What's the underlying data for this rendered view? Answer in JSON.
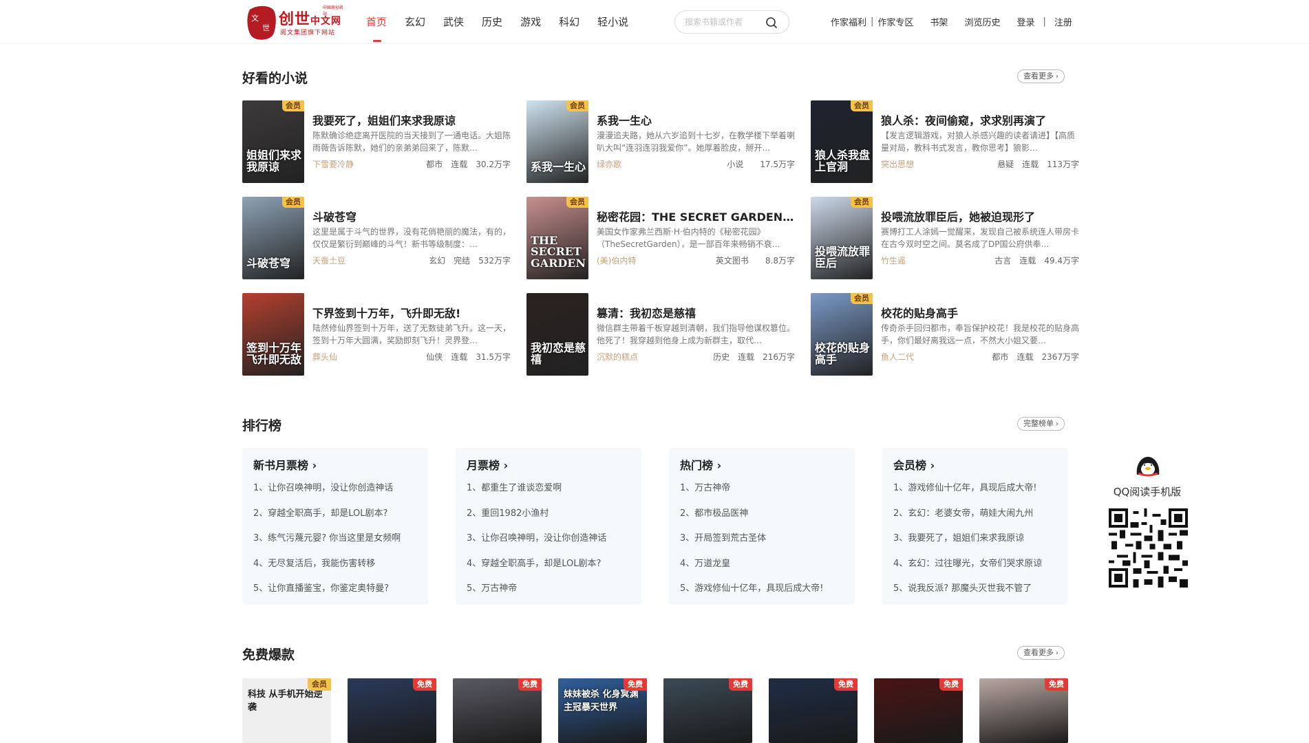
{
  "header": {
    "logo": {
      "seal_text": "文世",
      "brand_main": "创世",
      "brand_sub": "中文网",
      "tagline": "阅文集团旗下网站",
      "tiny": "中国原创名站"
    },
    "nav": [
      "首页",
      "玄幻",
      "武侠",
      "历史",
      "游戏",
      "科幻",
      "轻小说"
    ],
    "search_placeholder": "搜索书籍或作者",
    "links": {
      "author_welfare": "作家福利",
      "author_zone": "作家专区",
      "bookshelf": "书架",
      "history": "浏览历史",
      "login": "登录",
      "register": "注册"
    }
  },
  "section_good": {
    "title": "好看的小说",
    "more": "查看更多",
    "books": [
      {
        "title": "我要死了，姐姐们来求我原谅",
        "desc": "陈默确诊绝症离开医院的当天接到了一通电话。大姐陈雨薇告诉陈默，她们的亲弟弟回来了，陈默…",
        "author": "下雪要冷静",
        "genre": "都市",
        "status": "连载",
        "words": "30.2万字",
        "badge": "会员",
        "cover_text": "姐姐们来求我原谅",
        "cover_color": "#3d3a3b"
      },
      {
        "title": "系我一生心",
        "desc": "漫漫追夫路，她从六岁追到十七岁，在教学楼下举着喇叭大叫“连羽连羽我爱你”。她厚着脸皮，掰开…",
        "author": "绿亦歌",
        "genre": "小说",
        "status": "",
        "words": "17.5万字",
        "badge": "会员",
        "cover_text": "系我一生心",
        "cover_color": "#cfe3ef"
      },
      {
        "title": "狼人杀：夜间偷窥，求求别再演了",
        "desc": "【发言逻辑游戏，对狼人杀感兴趣的读者请进】【高质量对局，教科书式发言，教你思考】狼影…",
        "author": "突出思想",
        "genre": "悬疑",
        "status": "连载",
        "words": "113万字",
        "badge": "会员",
        "cover_text": "狼人杀我盘上官洞",
        "cover_color": "#1e2330"
      },
      {
        "title": "斗破苍穹",
        "desc": "这里是属于斗气的世界，没有花俏艳丽的魔法，有的，仅仅是繁衍到巅峰的斗气！新书等级制度：…",
        "author": "天蚕土豆",
        "genre": "玄幻",
        "status": "完结",
        "words": "532万字",
        "badge": "会员",
        "cover_text": "斗破苍穹",
        "cover_color": "#8ea3b5"
      },
      {
        "title": "秘密花园：THE SECRET GARDEN（英文原版）",
        "desc": "美国女作家弗兰西斯·H·伯内特的《秘密花园》（TheSecretGarden），是一部百年来畅销不衰…",
        "author": "(美)伯内特",
        "genre": "英文图书",
        "status": "",
        "words": "8.8万字",
        "badge": "会员",
        "cover_text": "THE SECRET GARDEN",
        "cover_color": "#c98f8f"
      },
      {
        "title": "投喂流放罪臣后，她被迫现形了",
        "desc": "赛博打工人涂嫣一觉醒来，发现自己被系统连人带房卡在古今双时空之间。莫名成了DP国公府供奉…",
        "author": "竹生遥",
        "genre": "古言",
        "status": "连载",
        "words": "49.4万字",
        "badge": "会员",
        "cover_text": "投喂流放罪臣后",
        "cover_color": "#cdd9e9"
      },
      {
        "title": "下界签到十万年，飞升即无敌!",
        "desc": "陆然修仙界签到十万年，送了无数徒弟飞升。这一天，签到十万年大圆满，奖励即刻飞升！灵界登…",
        "author": "葬头仙",
        "genre": "仙侠",
        "status": "连载",
        "words": "31.5万字",
        "badge": "",
        "cover_text": "签到十万年飞升即无敌",
        "cover_color": "#b4402e"
      },
      {
        "title": "篡清：我初恋是慈禧",
        "desc": "微信群主带着千板穿越到清朝，我们指导他谋权篡位。他死了！我穿越到他身上成为新群主，取代…",
        "author": "沉默的糕点",
        "genre": "历史",
        "status": "连载",
        "words": "216万字",
        "badge": "",
        "cover_text": "我初恋是慈禧",
        "cover_color": "#2a2220"
      },
      {
        "title": "校花的贴身高手",
        "desc": "传奇杀手回归都市，奉旨保护校花！我是校花的贴身高手，你们最好离我远一点，不然大小姐又要…",
        "author": "鱼人二代",
        "genre": "都市",
        "status": "连载",
        "words": "2367万字",
        "badge": "会员",
        "cover_text": "校花的贴身高手",
        "cover_color": "#7b9ac7"
      }
    ]
  },
  "section_rank": {
    "title": "排行榜",
    "more": "完整榜单",
    "panels": [
      {
        "title": "新书月票榜",
        "items": [
          "1、让你召唤神明，没让你创造神话",
          "2、穿越全职高手，却是LOL剧本?",
          "3、练气污蔑元婴? 你当这里是女频啊",
          "4、无尽复活后，我能伤害转移",
          "5、让你直播鉴宝，你鉴定奥特曼?"
        ]
      },
      {
        "title": "月票榜",
        "items": [
          "1、都重生了谁谈恋爱啊",
          "2、重回1982小渔村",
          "3、让你召唤神明，没让你创造神话",
          "4、穿越全职高手，却是LOL剧本?",
          "5、万古神帝"
        ]
      },
      {
        "title": "热门榜",
        "items": [
          "1、万古神帝",
          "2、都市极品医神",
          "3、开局签到荒古圣体",
          "4、万道龙皇",
          "5、游戏修仙十亿年，具现后成大帝!"
        ]
      },
      {
        "title": "会员榜",
        "items": [
          "1、游戏修仙十亿年，具现后成大帝!",
          "2、玄幻：老婆女帝，萌娃大闹九州",
          "3、我要死了，姐姐们来求我原谅",
          "4、玄幻：过往曝光，女帝们哭求原谅",
          "5、说我反派? 那魔头灭世我不管了"
        ]
      }
    ]
  },
  "qr": {
    "label": "QQ阅读手机版"
  },
  "section_free": {
    "title": "免费爆款",
    "more": "查看更多",
    "covers": [
      {
        "badge": "会员",
        "text": "科技 从手机开始逆袭",
        "color": "#efefef"
      },
      {
        "badge": "免费",
        "text": "",
        "color": "#2b3a5a"
      },
      {
        "badge": "免费",
        "text": "",
        "color": "#5a5a62"
      },
      {
        "badge": "免费",
        "text": "妹妹被杀 化身冥渊主冠暴天世界",
        "color": "#2f5f9e"
      },
      {
        "badge": "免费",
        "text": "",
        "color": "#3c4a55"
      },
      {
        "badge": "免费",
        "text": "",
        "color": "#1f2d44"
      },
      {
        "badge": "免费",
        "text": "",
        "color": "#4a1414"
      },
      {
        "badge": "免费",
        "text": "",
        "color": "#b9a7a2"
      }
    ]
  }
}
